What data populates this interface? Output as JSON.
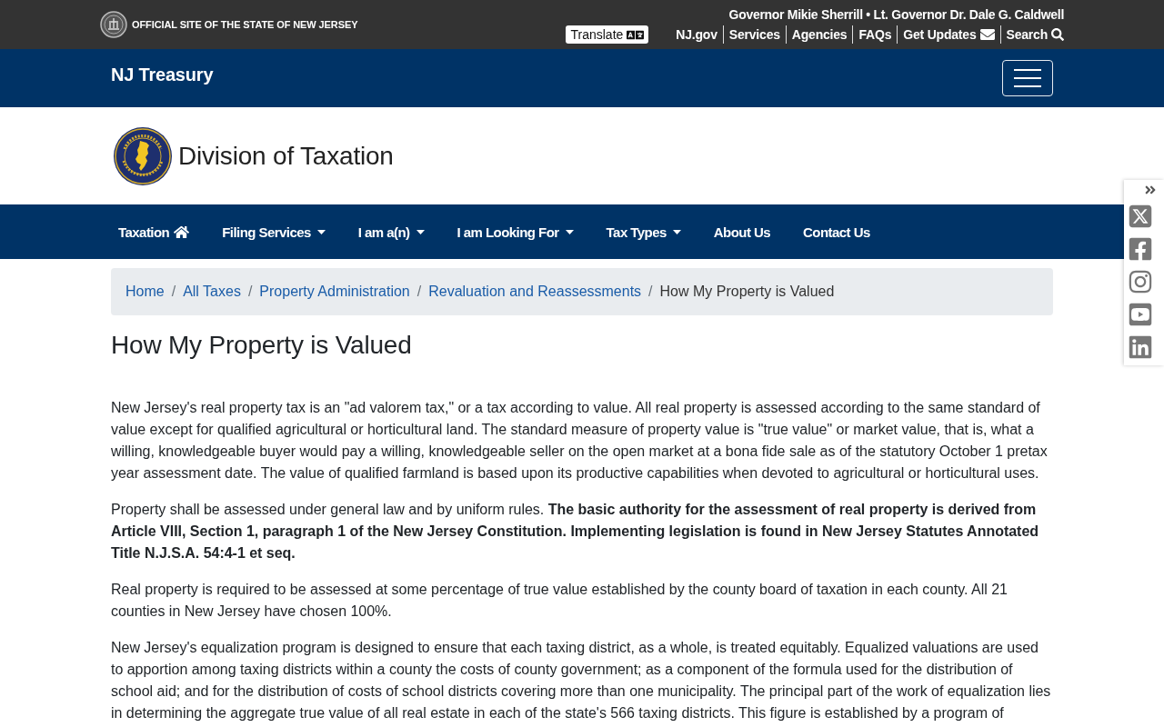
{
  "top_bar": {
    "site_label": "OFFICIAL SITE OF THE STATE OF NEW JERSEY",
    "officials": "Governor Mikie Sherrill • Lt. Governor Dr. Dale G. Caldwell",
    "translate_button": "Translate",
    "links": [
      {
        "label": "NJ.gov",
        "kind": "link"
      },
      {
        "label": "Services",
        "kind": "link"
      },
      {
        "label": "Agencies",
        "kind": "link"
      },
      {
        "label": "FAQs",
        "kind": "link"
      },
      {
        "label": "Get Updates",
        "kind": "mail"
      },
      {
        "label": "Search",
        "kind": "search"
      }
    ]
  },
  "navbar": {
    "title": "NJ Treasury"
  },
  "header": {
    "title": "Division of Taxation"
  },
  "menu": [
    {
      "label": "Taxation",
      "kind": "home"
    },
    {
      "label": "Filing Services",
      "kind": "dropdown"
    },
    {
      "label": "I am a(n)",
      "kind": "dropdown"
    },
    {
      "label": "I am Looking For",
      "kind": "dropdown"
    },
    {
      "label": "Tax Types",
      "kind": "dropdown"
    },
    {
      "label": "About Us",
      "kind": "link"
    },
    {
      "label": "Contact Us",
      "kind": "link"
    }
  ],
  "breadcrumb": [
    {
      "label": "Home",
      "current": false
    },
    {
      "separator": "/",
      "label": "All Taxes",
      "current": false
    },
    {
      "separator": "/",
      "label": "Property Administration",
      "current": false
    },
    {
      "separator": "/",
      "label": "Revaluation and Reassessments",
      "current": false
    },
    {
      "separator": "/",
      "label": "How My Property is Valued",
      "current": true
    }
  ],
  "page_title": "How My Property is Valued",
  "paragraphs": [
    "New Jersey's real property tax is an \"ad valorem tax,\" or a tax according to value. All real property is assessed according to the same standard of value except for qualified agricultural or horticultural land. The standard measure of property value is \"true value\" or market value, that is, what a willing, knowledgeable buyer would pay a willing, knowledgeable seller on the open market at a bona fide sale as of the statutory October 1 pretax year assessment date. The value of qualified farmland is based upon its productive capabilities when devoted to agricultural or horticultural uses.",
    "Property shall be assessed under general law and by uniform rules. **The basic authority for the assessment of real property is derived from Article VIII, Section 1, paragraph 1 of the New Jersey Constitution. Implementing legislation is found in New Jersey Statutes Annotated Title N.J.S.A. 54:4-1 et seq.**",
    "Real property is required to be assessed at some percentage of true value established by the county board of taxation in each county. All 21 counties in New Jersey have chosen 100%.",
    "New Jersey's equalization program is designed to ensure that each taxing district, as a whole, is treated equitably. Equalized valuations are used to apportion among taxing districts within a county the costs of county government; as a component of the formula used for the distribution of school aid; and for the distribution of costs of school districts covering more than one municipality. The principal part of the work of equalization lies in determining the aggregate true value of all real estate in each of the state's 566 taxing districts. This figure is established by a program of"
  ]
}
